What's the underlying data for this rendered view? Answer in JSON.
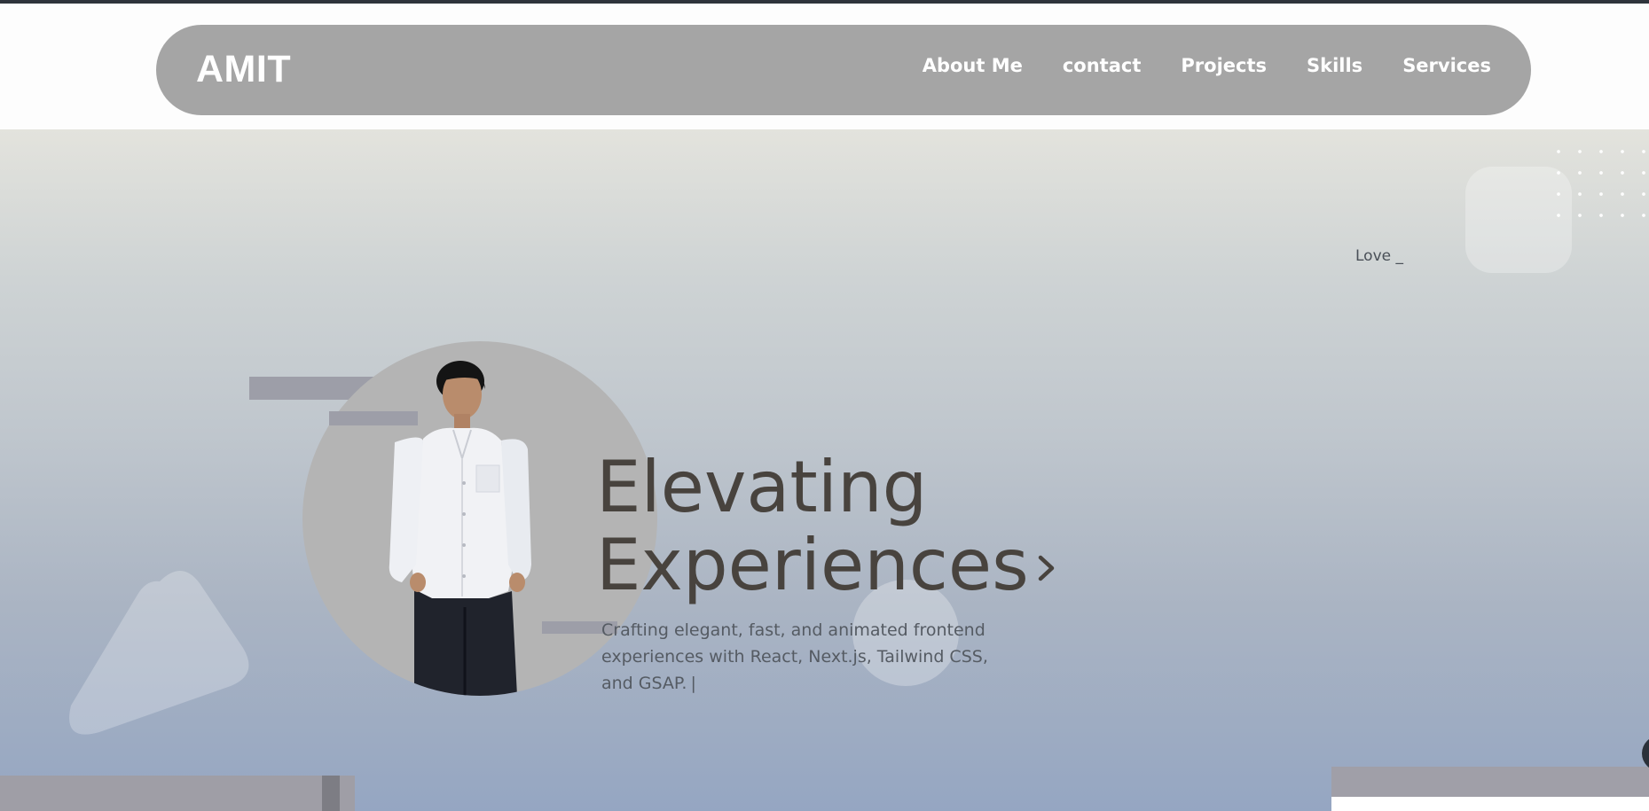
{
  "header": {
    "logo": "AMIT",
    "nav": [
      {
        "label": "About Me"
      },
      {
        "label": "contact"
      },
      {
        "label": "Projects"
      },
      {
        "label": "Skills"
      },
      {
        "label": "Services"
      }
    ]
  },
  "hero": {
    "typed_text": "Love _",
    "title_line1": "Elevating",
    "title_line2": "Experiences",
    "subtitle": "Crafting elegant, fast, and animated frontend experiences with React, Next.js, Tailwind CSS, and GSAP.",
    "cursor": "|",
    "icons": {
      "arrow": "chevron-right-icon",
      "portrait": "profile-photo"
    }
  },
  "colors": {
    "navbar": "#a5a5a5",
    "title_text": "#48433e",
    "hero_gradient_top": "#e3e3dd",
    "hero_gradient_bottom": "#95a6c2"
  }
}
